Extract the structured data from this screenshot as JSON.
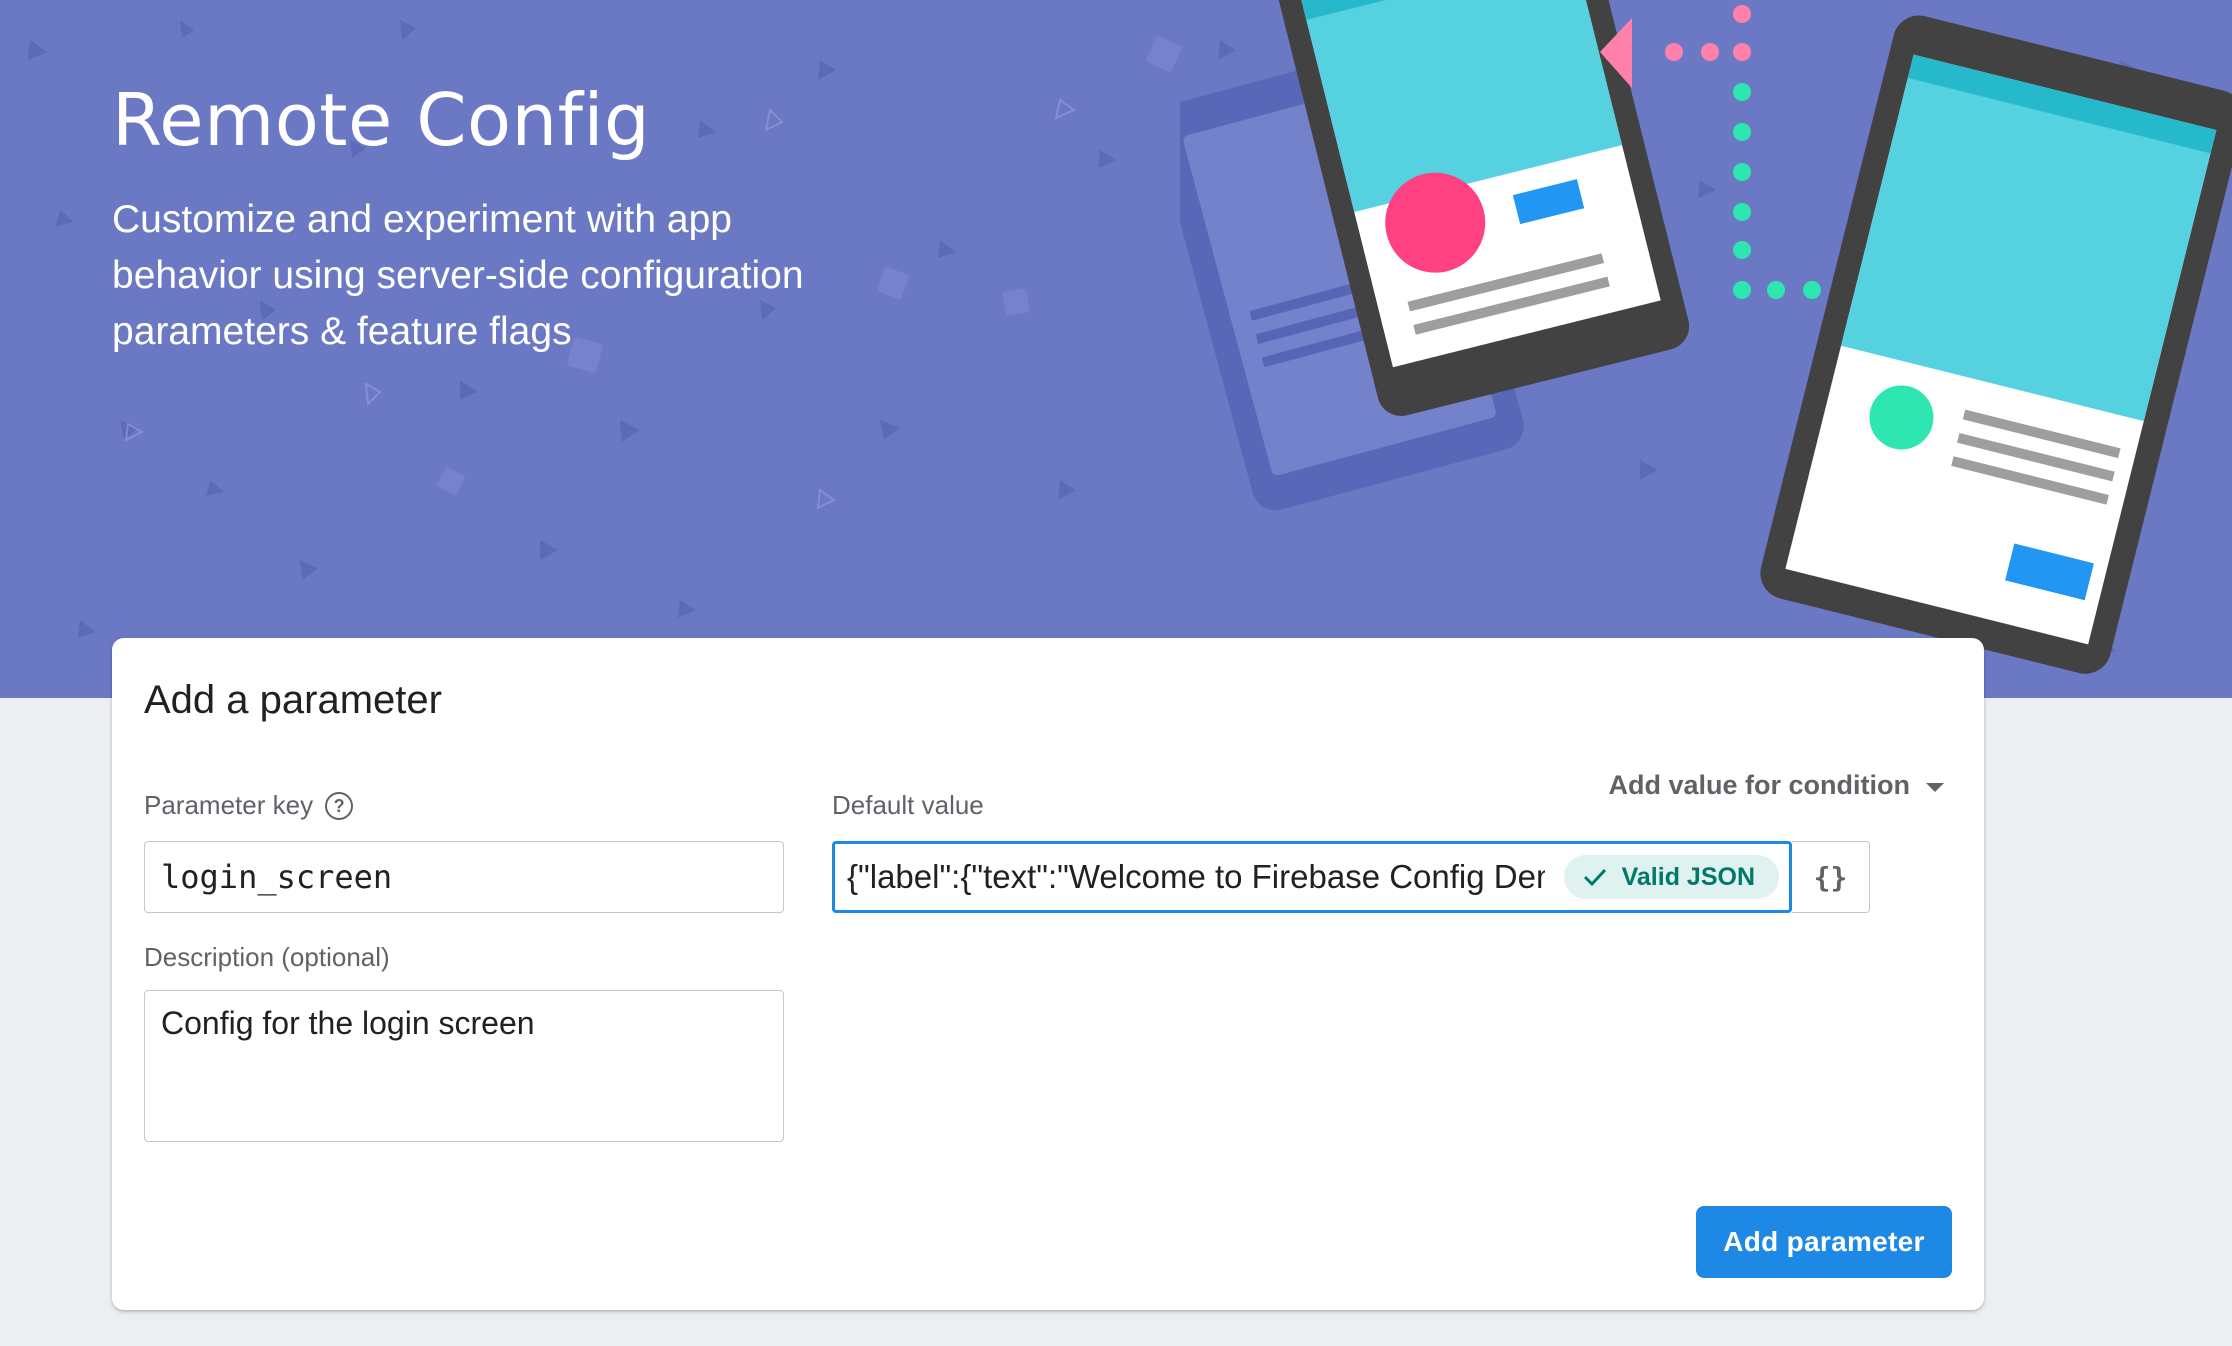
{
  "hero": {
    "title": "Remote Config",
    "subtitle": "Customize and experiment with app behavior using server-side configuration parameters & feature flags",
    "illustration_icon": "phones-sync-illustration",
    "colors": {
      "background": "#6b79c5",
      "phone_frame": "#424242",
      "screen_cyan": "#56d1e0",
      "pink": "#ff4081",
      "teal": "#2ee6b0",
      "blue": "#2196f3"
    }
  },
  "form": {
    "title": "Add a parameter",
    "parameter_key": {
      "label": "Parameter key",
      "help_icon": "help-circle-icon",
      "value": "login_screen"
    },
    "description": {
      "label": "Description (optional)",
      "value": "Config for the login screen"
    },
    "default_value": {
      "label": "Default value",
      "value": "{\"label\":{\"text\":\"Welcome to Firebase Config Demo\"",
      "validation_badge": "Valid JSON",
      "validation_icon": "check-icon"
    },
    "condition_dropdown": {
      "label": "Add value for condition",
      "icon": "caret-down-icon"
    },
    "format_button": {
      "label": "{}",
      "icon": "json-braces-icon"
    },
    "submit_button": {
      "label": "Add parameter",
      "color": "#1e88e5"
    }
  }
}
